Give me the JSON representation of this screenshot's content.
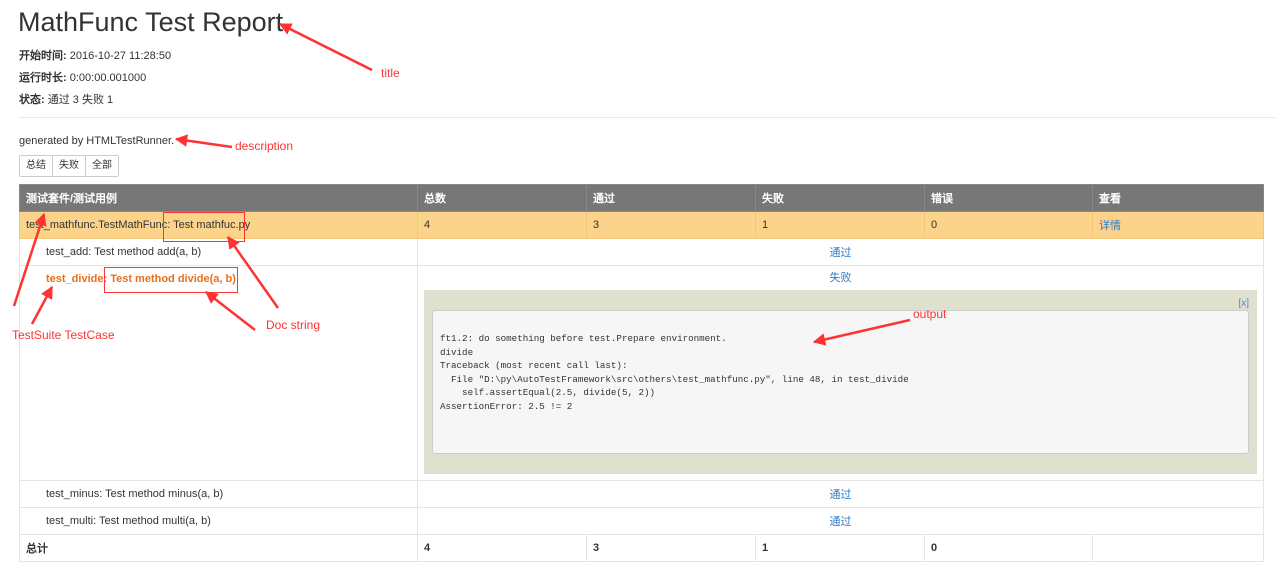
{
  "report": {
    "title": "MathFunc Test Report",
    "start_label": "开始时间:",
    "start_value": "2016-10-27 11:28:50",
    "duration_label": "运行时长:",
    "duration_value": "0:00:00.001000",
    "status_label": "状态:",
    "status_value": "通过 3 失败 1",
    "description": "generated by HTMLTestRunner."
  },
  "filters": [
    "总结",
    "失败",
    "全部"
  ],
  "table": {
    "headers": [
      "测试套件/测试用例",
      "总数",
      "通过",
      "失败",
      "错误",
      "查看"
    ],
    "suite": {
      "name": "test_mathfunc.TestMathFunc",
      "doc": "Test mathfuc.py",
      "count": "4",
      "pass": "3",
      "fail": "1",
      "error": "0",
      "view": "详情"
    },
    "cases": [
      {
        "name": "test_add",
        "doc": "Test method add(a, b)",
        "status": "通过"
      },
      {
        "name": "test_divide",
        "doc": "Test method divide(a, b)",
        "status": "失败"
      },
      {
        "name": "test_minus",
        "doc": "Test method minus(a, b)",
        "status": "通过"
      },
      {
        "name": "test_multi",
        "doc": "Test method multi(a, b)",
        "status": "通过"
      }
    ],
    "total": {
      "label": "总计",
      "count": "4",
      "pass": "3",
      "fail": "1",
      "error": "0"
    }
  },
  "failure": {
    "close": "[x]",
    "output": "ft1.2: do something before test.Prepare environment.\ndivide\nTraceback (most recent call last):\n  File \"D:\\py\\AutoTestFramework\\src\\others\\test_mathfunc.py\", line 48, in test_divide\n    self.assertEqual(2.5, divide(5, 2))\nAssertionError: 2.5 != 2"
  },
  "annotations": {
    "title": "title",
    "description": "description",
    "docstring": "Doc string",
    "output": "output",
    "suite_case": "TestSuite TestCase"
  },
  "colors": {
    "suite_row": "#fbd38b",
    "header": "#777777",
    "fail_text": "#e6701c",
    "link": "#2f7bc6",
    "annotation": "#ff3333"
  }
}
